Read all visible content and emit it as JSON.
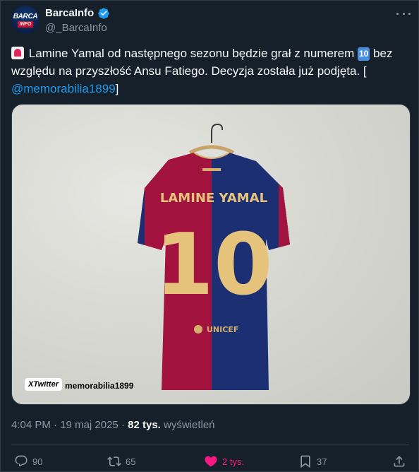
{
  "author": {
    "display_name": "BarcaInfo",
    "handle": "@_BarcaInfo",
    "avatar_text": "BARCA",
    "avatar_text2": "INFO",
    "verified": true,
    "verified_color": "#1d9bf0"
  },
  "tweet": {
    "text_part1": "Lamine Yamal od następnego sezonu będzie grał z numerem",
    "emoji_ten": "10",
    "text_part2": "bez względu na przyszłość Ansu Fatiego. Decyzja została już podjęta. [",
    "mention": "@memorabilia1899",
    "text_part3": "]",
    "leading_emoji": "police-light-emoji"
  },
  "photo": {
    "jersey_name": "LAMINE YAMAL",
    "jersey_number": "10",
    "sponsor_text": "UNICEF",
    "watermark_logo": "XTwitter",
    "watermark_text": "memorabilia1899"
  },
  "meta": {
    "time": "4:04 PM",
    "separator": "·",
    "date": "19 maj 2025",
    "views_count": "82 tys.",
    "views_label": "wyświetleń"
  },
  "actions": {
    "replies": "90",
    "reposts": "65",
    "likes": "2 tys.",
    "bookmarks": "37",
    "like_color": "#f91880"
  },
  "colors": {
    "background": "#15202b",
    "text": "#f7f9f9",
    "secondary": "#8b98a5",
    "accent": "#1d9bf0"
  }
}
